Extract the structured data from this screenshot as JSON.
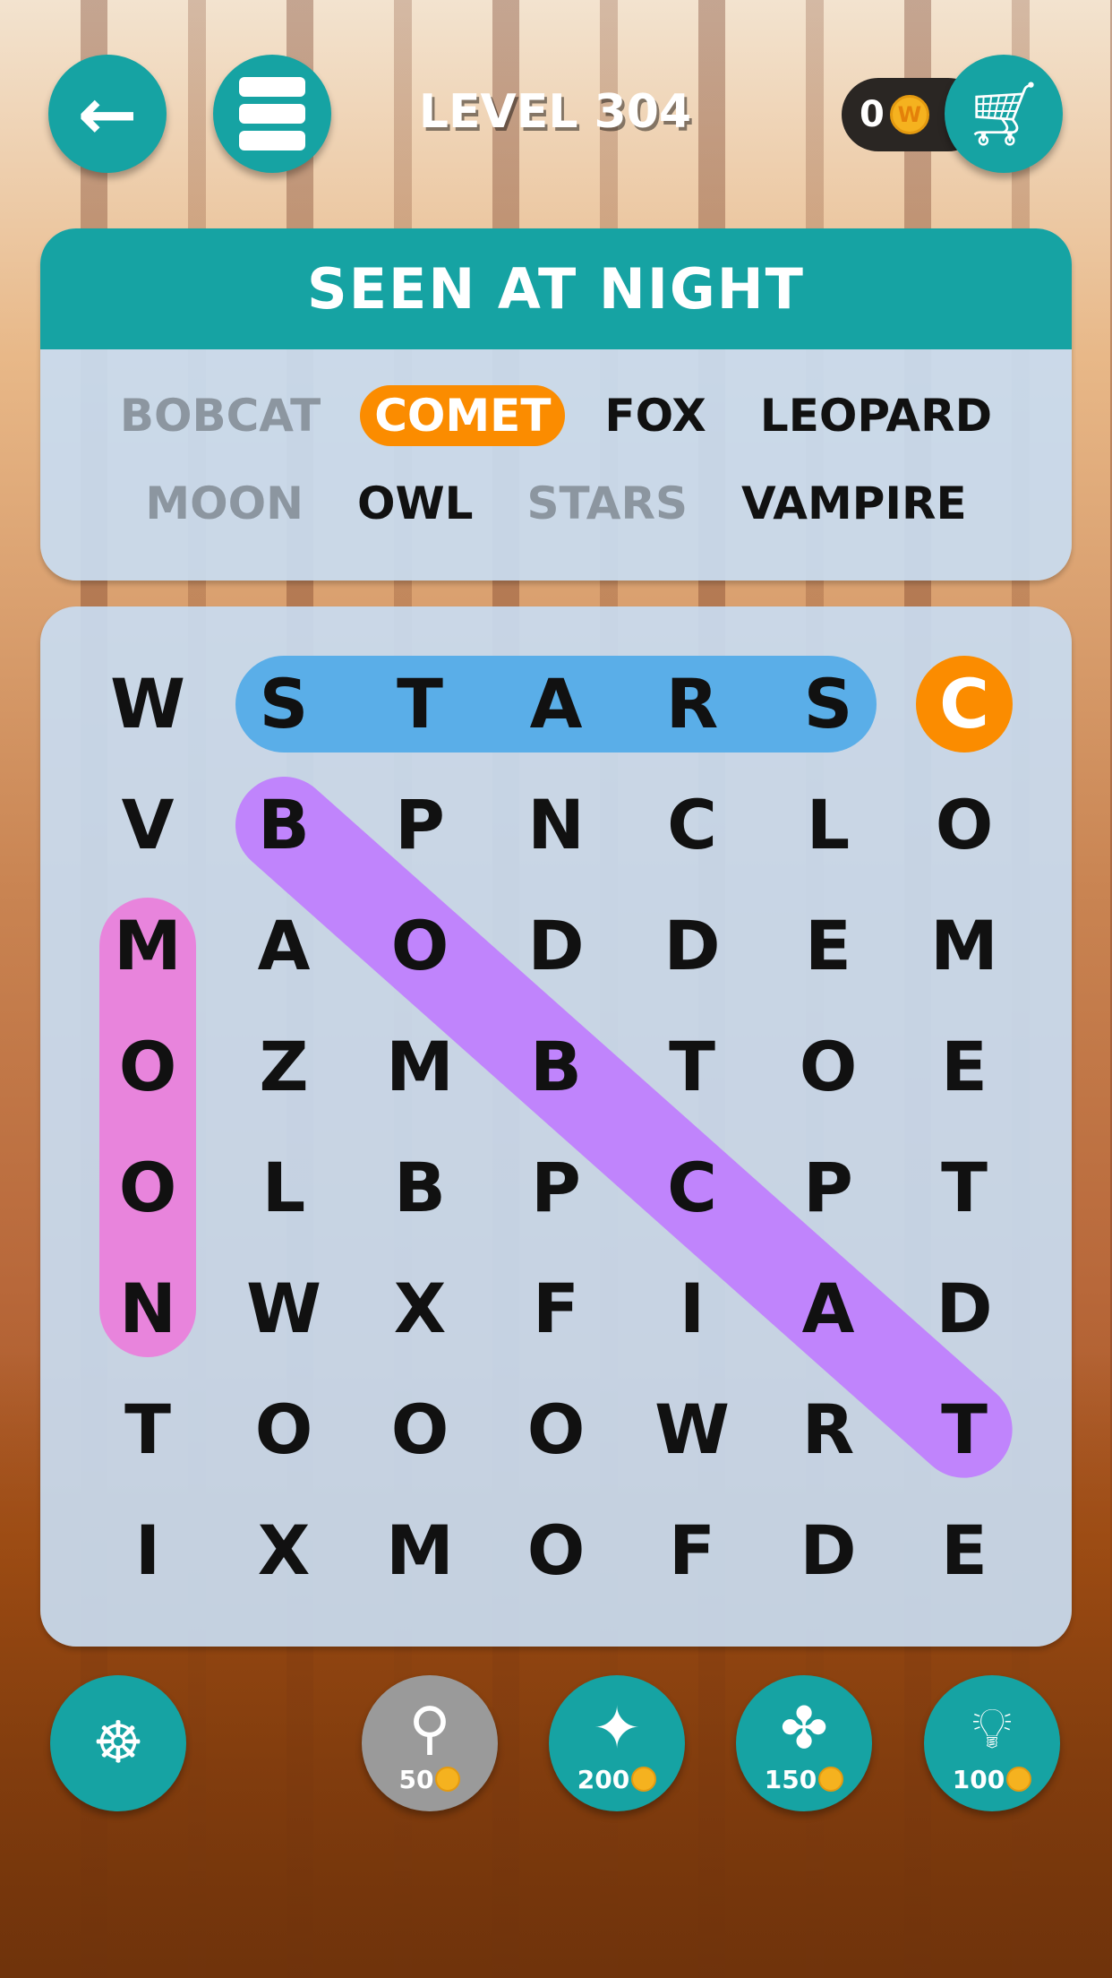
{
  "header": {
    "level": "LEVEL 304",
    "coins": "0",
    "coin_symbol": "W"
  },
  "category": {
    "title": "SEEN AT NIGHT",
    "words": [
      [
        {
          "text": "BOBCAT",
          "state": "found"
        },
        {
          "text": "COMET",
          "state": "hint"
        },
        {
          "text": "FOX",
          "state": "todo"
        },
        {
          "text": "LEOPARD",
          "state": "todo"
        }
      ],
      [
        {
          "text": "MOON",
          "state": "found"
        },
        {
          "text": "OWL",
          "state": "todo"
        },
        {
          "text": "STARS",
          "state": "found"
        },
        {
          "text": "VAMPIRE",
          "state": "todo"
        }
      ]
    ]
  },
  "grid": {
    "rows": [
      "WSTARSC",
      "VBPNCLO",
      "MAODDEM",
      "OZMBTOE",
      "OLBPCPT",
      "NWXFIAD",
      "TOOOWRT",
      "IXMOFDE"
    ],
    "found": [
      {
        "word": "STARS",
        "from": [
          0,
          1
        ],
        "to": [
          0,
          5
        ],
        "color": "#5aaee8"
      },
      {
        "word": "BOBCAT",
        "from": [
          1,
          1
        ],
        "to": [
          6,
          6
        ],
        "color": "#c084fc"
      },
      {
        "word": "MOON",
        "from": [
          2,
          0
        ],
        "to": [
          5,
          0
        ],
        "color": "#e884dc"
      }
    ],
    "hint_cell": {
      "cell": [
        0,
        6
      ],
      "color": "#fb8c00"
    }
  },
  "tools": [
    {
      "name": "spin-wheel",
      "cost": ""
    },
    {
      "name": "magnifier",
      "cost": "50",
      "disabled": true
    },
    {
      "name": "rocket",
      "cost": "200"
    },
    {
      "name": "fan",
      "cost": "150"
    },
    {
      "name": "lightbulb",
      "cost": "100"
    }
  ],
  "colors": {
    "accent": "#16a3a3",
    "hint": "#fb8c00"
  }
}
